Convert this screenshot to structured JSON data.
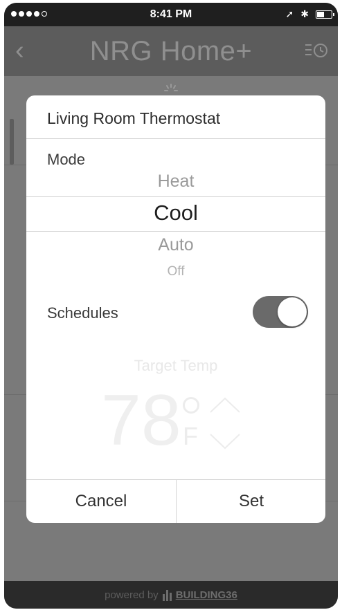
{
  "status_bar": {
    "time": "8:41 PM"
  },
  "nav": {
    "title": "NRG Home+",
    "back_icon": "chevron-left-icon",
    "schedule_icon": "schedule-clock-icon"
  },
  "modal": {
    "title": "Living Room Thermostat",
    "mode_label": "Mode",
    "mode_options": [
      "Heat",
      "Cool",
      "Auto",
      "Off"
    ],
    "selected_mode": "Cool",
    "schedules_label": "Schedules",
    "schedules_on": true,
    "target_temp_label": "Target Temp",
    "target_temp_value": "78",
    "temp_unit": "F",
    "cancel_label": "Cancel",
    "set_label": "Set"
  },
  "footer": {
    "powered_by": "powered by",
    "brand": "BUILDING36"
  },
  "colors": {
    "overlay": "#7a7a7a",
    "toggle_on": "#6a6a6a",
    "footer": "#2a2a2a"
  }
}
